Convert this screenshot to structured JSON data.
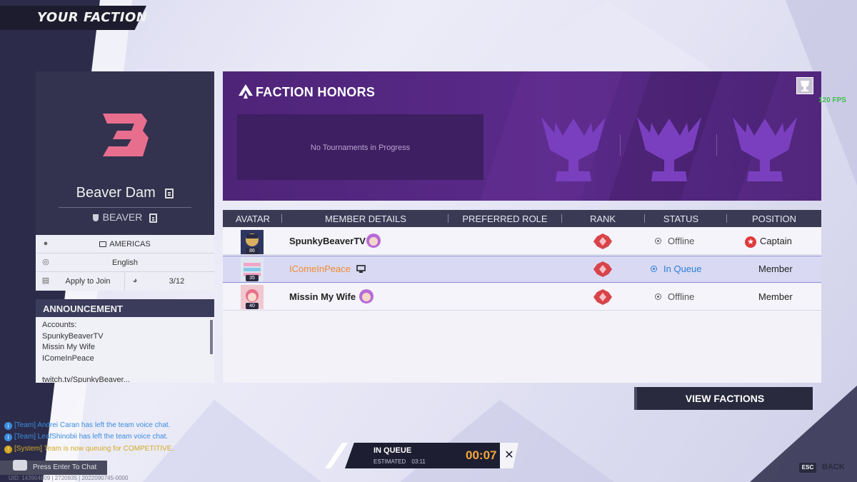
{
  "header": {
    "title": "YOUR FACTION"
  },
  "faction": {
    "name": "Beaver Dam",
    "tag": "BEAVER",
    "region": "AMERICAS",
    "language": "English",
    "join_label": "Apply to Join",
    "member_count": "3/12"
  },
  "announcement": {
    "title": "ANNOUNCEMENT",
    "lines": [
      "Accounts:",
      "SpunkyBeaverTV",
      "Missin My Wife",
      "IComeInPeace",
      "twitch.tv/SpunkyBeaver..."
    ]
  },
  "honors": {
    "title": "FACTION HONORS",
    "empty_text": "No Tournaments in Progress"
  },
  "fps": "120 FPS",
  "table": {
    "columns": [
      "AVATAR",
      "MEMBER DETAILS",
      "PREFERRED ROLE",
      "RANK",
      "STATUS",
      "POSITION"
    ],
    "rows": [
      {
        "level": "86",
        "name": "SpunkyBeaverTV",
        "status": "Offline",
        "position": "Captain"
      },
      {
        "level": "35",
        "name": "IComeInPeace",
        "status": "In Queue",
        "position": "Member"
      },
      {
        "level": "40",
        "name": "Missin My Wife",
        "status": "Offline",
        "position": "Member"
      }
    ]
  },
  "view_factions_label": "VIEW FACTIONS",
  "chat": {
    "messages": [
      {
        "type": "team",
        "text": "[Team] Andrei Caran has left the team voice chat."
      },
      {
        "type": "team",
        "text": "[Team] LeafShinobii has left the team voice chat."
      },
      {
        "type": "system",
        "text": "[System] Team is now queuing for COMPETITIVE."
      }
    ],
    "input_hint": "Press Enter To Chat",
    "uid": "UID: 143904809 | 2720935 | 2022090745-0000"
  },
  "queue": {
    "title": "IN QUEUE",
    "estimated_label": "ESTIMATED",
    "estimated_time": "03:11",
    "elapsed": "00:07"
  },
  "back": {
    "key": "ESC",
    "label": "BACK"
  },
  "colors": {
    "accent_purple": "#5a2a8a",
    "dark_panel": "#33334f",
    "queue_timer": "#f2a83a",
    "in_queue_status": "#2a7fd8",
    "highlight_name": "#f08a30"
  }
}
